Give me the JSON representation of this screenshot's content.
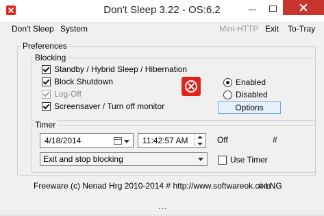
{
  "window": {
    "title": "Don't Sleep 3.22 - OS:6.2"
  },
  "menu": {
    "dont_sleep": "Don't Sleep",
    "system": "System",
    "mini_http": "Mini-HTTP",
    "exit": "Exit",
    "to_tray": "To-Tray"
  },
  "preferences": {
    "label": "Preferences",
    "blocking": {
      "label": "Blocking",
      "items": [
        {
          "label": "Standby / Hybrid Sleep / Hibernation",
          "checked": true
        },
        {
          "label": "Block Shutdown",
          "checked": true
        },
        {
          "label": "Log-Off",
          "checked": true,
          "disabled": true
        },
        {
          "label": "Screensaver / Turn off monitor",
          "checked": true
        }
      ],
      "enabled_label": "Enabled",
      "disabled_label": "Disabled",
      "selected": "Enabled",
      "options_button": "Options"
    },
    "timer": {
      "label": "Timer",
      "date": "4/18/2014",
      "time": "11:42:57 AM",
      "status": "Off",
      "hash": "#",
      "action": "Exit and stop blocking",
      "use_timer_label": "Use Timer",
      "use_timer_checked": false
    }
  },
  "footer": {
    "text": "Freeware (c) Nenad Hrg 2010-2014 # http://www.softwareok.com",
    "lng": "# LNG",
    "more": "..."
  },
  "colors": {
    "accent_red": "#e2231a",
    "close_button": "#c7352e",
    "button_blue": "#e5f1fb"
  },
  "icons": [
    "app-icon",
    "stop-icon",
    "calendar-icon",
    "dropdown-arrow-icon",
    "spinner-icon"
  ]
}
